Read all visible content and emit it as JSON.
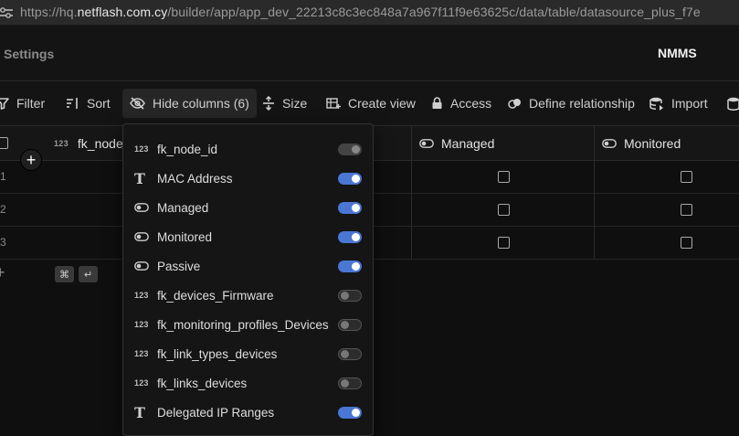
{
  "browser": {
    "url_prefix": "https://hq.",
    "url_host": "netflash.com.cy",
    "url_path": "/builder/app/app_dev_22213c8c3ec848a7a967f11f9e63625c/data/table/datasource_plus_f7e"
  },
  "header": {
    "settings_label": "Settings",
    "title": "NMMS"
  },
  "toolbar": {
    "filter": "Filter",
    "sort": "Sort",
    "hide_columns": "Hide columns (6)",
    "size": "Size",
    "create_view": "Create view",
    "access": "Access",
    "define_relationship": "Define relationship",
    "import": "Import"
  },
  "table": {
    "columns": [
      {
        "name": "fk_node_",
        "type": "123"
      },
      {
        "name": "Managed",
        "type": "toggle"
      },
      {
        "name": "Monitored",
        "type": "toggle"
      }
    ],
    "rows": [
      {
        "num": "1",
        "managed": false,
        "monitored": false
      },
      {
        "num": "2",
        "managed": false,
        "monitored": false
      },
      {
        "num": "3",
        "managed": false,
        "monitored": false
      }
    ],
    "add_row_symbol": "+",
    "shortcut_keys": [
      "⌘",
      "↵"
    ]
  },
  "hide_columns_menu": {
    "items": [
      {
        "label": "fk_node_id",
        "type": "123",
        "visible": true,
        "disabled": true
      },
      {
        "label": "MAC Address",
        "type": "text",
        "visible": true
      },
      {
        "label": "Managed",
        "type": "toggle",
        "visible": true
      },
      {
        "label": "Monitored",
        "type": "toggle",
        "visible": true
      },
      {
        "label": "Passive",
        "type": "toggle",
        "visible": true
      },
      {
        "label": "fk_devices_Firmware",
        "type": "123",
        "visible": false
      },
      {
        "label": "fk_monitoring_profiles_Devices",
        "type": "123",
        "visible": false
      },
      {
        "label": "fk_link_types_devices",
        "type": "123",
        "visible": false
      },
      {
        "label": "fk_links_devices",
        "type": "123",
        "visible": false
      },
      {
        "label": "Delegated IP Ranges",
        "type": "text",
        "visible": true
      }
    ]
  },
  "colors": {
    "accent": "#4a77d4",
    "background": "#0f0f0f"
  }
}
